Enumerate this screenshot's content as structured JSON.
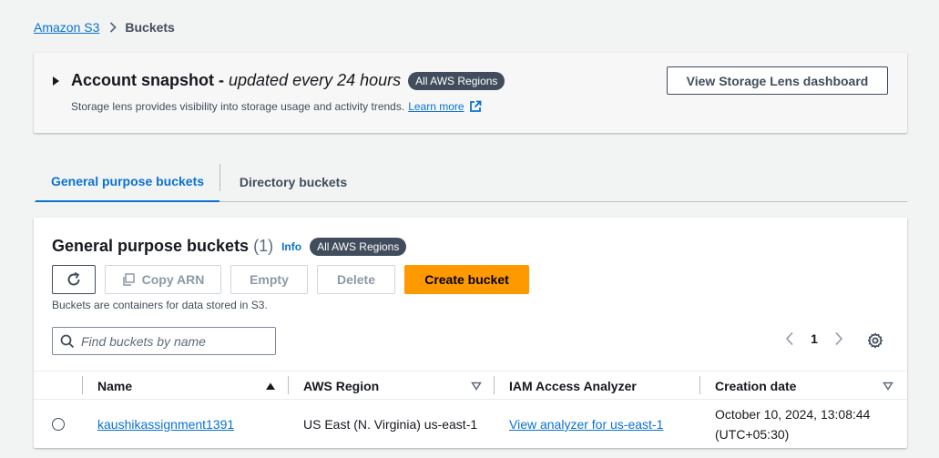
{
  "breadcrumb": {
    "root": "Amazon S3",
    "current": "Buckets"
  },
  "snapshot": {
    "title": "Account snapshot -",
    "subtitle": "updated every 24 hours",
    "badge": "All AWS Regions",
    "description": "Storage lens provides visibility into storage usage and activity trends.",
    "learn_more": "Learn more",
    "button": "View Storage Lens dashboard"
  },
  "tabs": [
    {
      "label": "General purpose buckets",
      "active": true
    },
    {
      "label": "Directory buckets",
      "active": false
    }
  ],
  "panel": {
    "title": "General purpose buckets",
    "count": "(1)",
    "info": "Info",
    "badge": "All AWS Regions",
    "actions": {
      "copy_arn": "Copy ARN",
      "empty": "Empty",
      "delete": "Delete",
      "create": "Create bucket"
    },
    "description": "Buckets are containers for data stored in S3.",
    "search_placeholder": "Find buckets by name",
    "page": "1"
  },
  "table": {
    "columns": [
      "Name",
      "AWS Region",
      "IAM Access Analyzer",
      "Creation date"
    ],
    "rows": [
      {
        "name": "kaushikassignment1391",
        "region": "US East (N. Virginia) us-east-1",
        "analyzer": "View analyzer for us-east-1",
        "created_line1": "October 10, 2024, 13:08:44",
        "created_line2": "(UTC+05:30)"
      }
    ]
  },
  "colors": {
    "accent": "#0972d3",
    "primary_button": "#ff9900",
    "badge": "#414d5c"
  }
}
